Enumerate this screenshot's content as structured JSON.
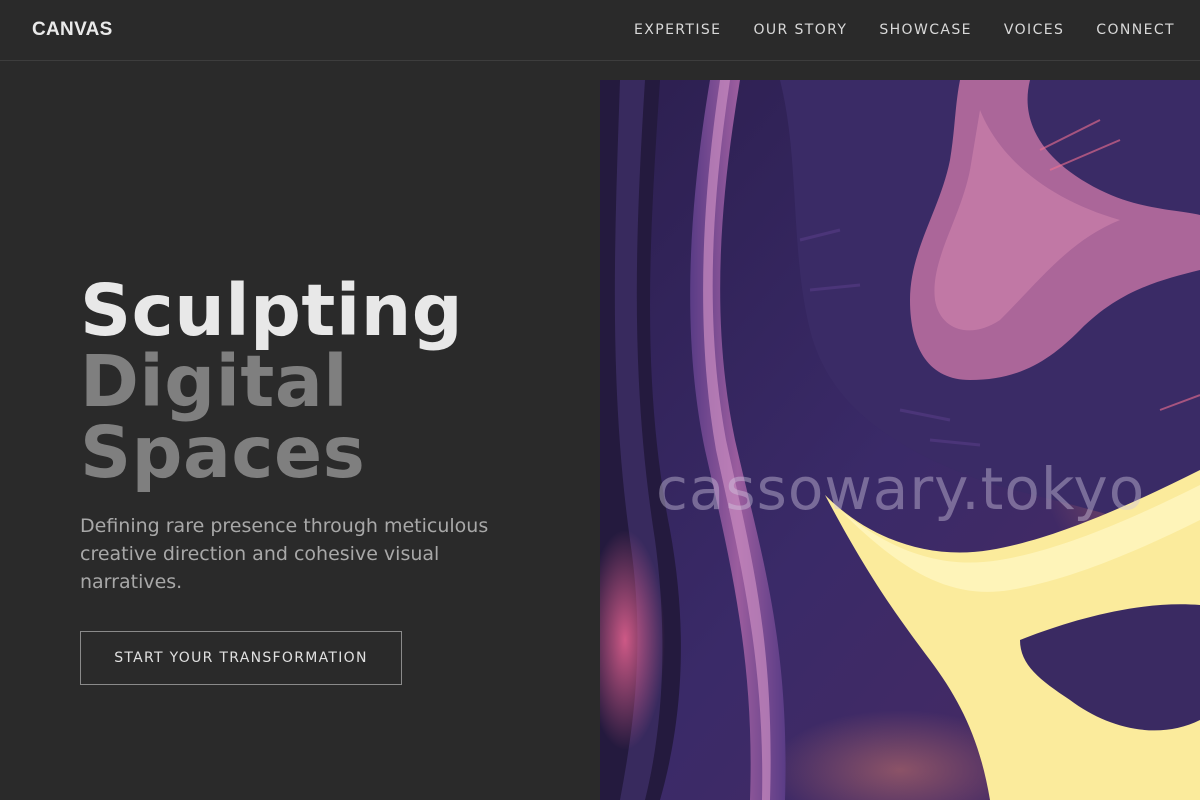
{
  "header": {
    "logo": "CANVAS",
    "nav": [
      "EXPERTISE",
      "OUR STORY",
      "SHOWCASE",
      "VOICES",
      "CONNECT"
    ]
  },
  "hero": {
    "headline": [
      "Sculpting",
      "Digital",
      "Spaces"
    ],
    "subtitle": "Defining rare presence through meticulous creative direction and cohesive visual narratives.",
    "cta": "START YOUR TRANSFORMATION"
  },
  "image": {
    "watermark": "cassowary.tokyo",
    "subject": "abstract purple and pink brush-stroke swirls with a glowing yellow form"
  },
  "colors": {
    "background": "#2a2a2a",
    "headline_primary": "#e8e8e8",
    "headline_muted": "#7f7f7f",
    "art_purple": "#3b2a66",
    "art_pink": "#c4689e",
    "art_yellow": "#fdf0a0"
  }
}
